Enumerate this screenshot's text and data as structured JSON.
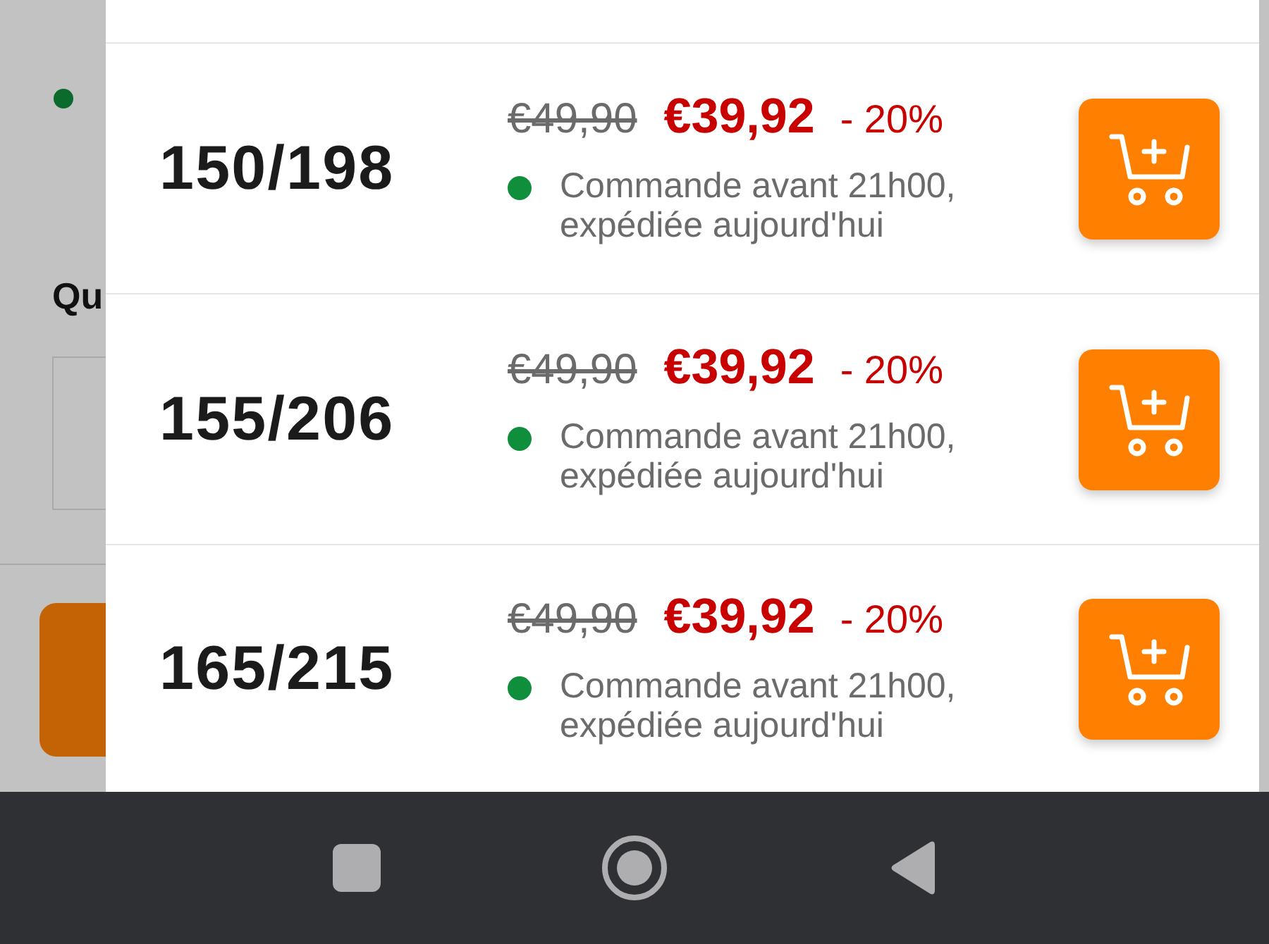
{
  "backdrop": {
    "heading": "Qu"
  },
  "variants": [
    {
      "size": "150/198",
      "old_price": "€49,90",
      "price": "€39,92",
      "discount": "- 20%",
      "availability": {
        "color": "#0f8f3c",
        "text": "Commande avant 21h00, expédiée aujourd'hui"
      }
    },
    {
      "size": "155/206",
      "old_price": "€49,90",
      "price": "€39,92",
      "discount": "- 20%",
      "availability": {
        "color": "#0f8f3c",
        "text": "Commande avant 21h00, expédiée aujourd'hui"
      }
    },
    {
      "size": "165/215",
      "old_price": "€49,90",
      "price": "€39,92",
      "discount": "- 20%",
      "availability": {
        "color": "#0f8f3c",
        "text": "Commande avant 21h00, expédiée aujourd'hui"
      }
    }
  ]
}
